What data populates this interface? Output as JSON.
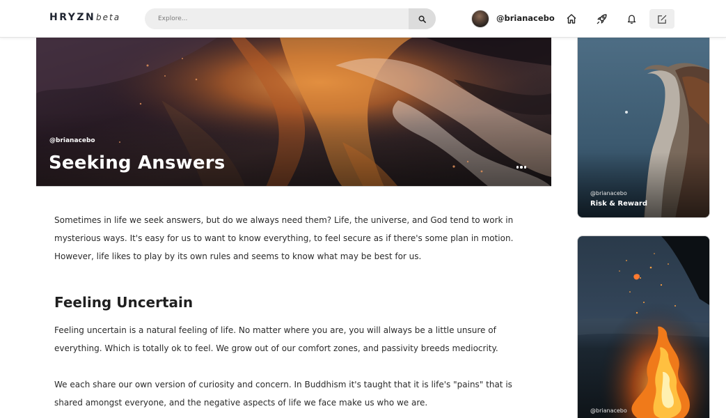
{
  "header": {
    "logo": "HRYZN",
    "logo_suffix": "beta",
    "search_placeholder": "Explore...",
    "username": "@brianacebo",
    "icons": [
      "search-icon",
      "home-icon",
      "rocket-icon",
      "bell-icon",
      "compose-icon"
    ]
  },
  "hero": {
    "author": "@brianacebo",
    "title": "Seeking Answers"
  },
  "article": {
    "paragraph1": "Sometimes in life we seek answers, but do we always need them? Life, the universe, and God tend to work in mysterious ways. It's easy for us to want to know everything, to feel secure as if there's some plan in motion. However, life likes to play by its own rules and seems to know what may be best for us.",
    "heading1": "Feeling Uncertain",
    "paragraph2": "Feeling uncertain is a natural feeling of life. No matter where you are, you will always be a little unsure of everything. Which is totally ok to feel. We grow out of our comfort zones, and passivity breeds mediocrity.",
    "paragraph3": "We each share our own version of curiosity and concern. In Buddhism it's taught that it is life's \"pains\" that is shared amongst everyone, and the negative aspects of life we face make us who we are."
  },
  "sidebar": {
    "cards": [
      {
        "author": "@brianacebo",
        "title": "Risk & Reward"
      },
      {
        "author": "@brianacebo",
        "title": ""
      }
    ]
  }
}
